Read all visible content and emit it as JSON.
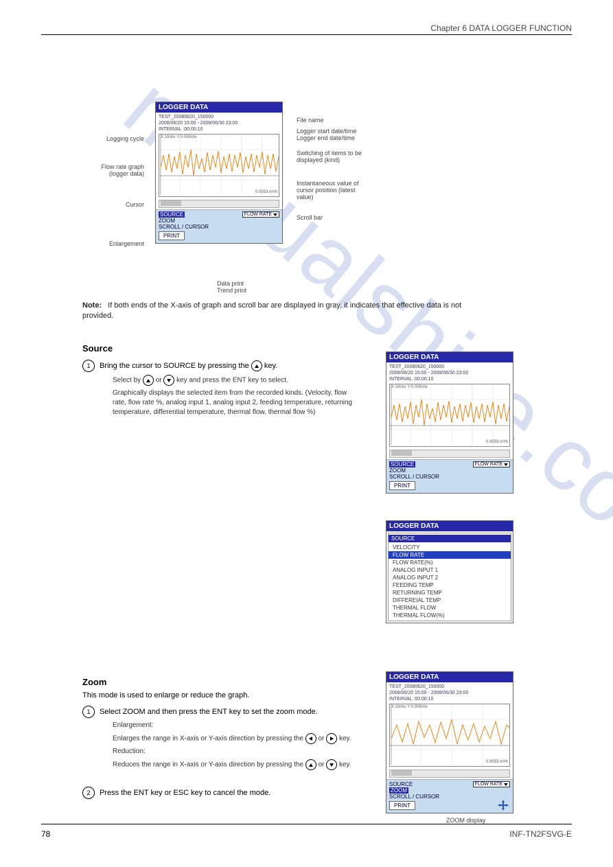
{
  "header": {
    "right_text": "Chapter 6  DATA LOGGER FUNCTION"
  },
  "panel_common": {
    "title": "LOGGER DATA",
    "file": "TEST_20080620_150000",
    "range": "2008/06/20 15:00 - 2008/06/30 23:00",
    "interval": "INTERVAL :00:00:10",
    "axis": "X:18/div Y:0.008/div",
    "value": "0.0053 m³/h"
  },
  "ctrl": {
    "source": "SOURCE",
    "flow_rate": "FLOW RATE",
    "zoom": "ZOOM",
    "scroll": "SCROLL / CURSOR",
    "print": "PRINT"
  },
  "callouts": {
    "file_name": "File name",
    "start_end": "Logger start date/time\nLogger end date/time",
    "logging_cycle": "Logging cycle",
    "switch_item": "Switching of items to be\ndisplayed (kind)",
    "flow_rate_graph": "Flow rate graph\n(logger data)",
    "instantaneous": "Instantaneous value of\ncursor position (latest\nvalue)",
    "cursor": "Cursor",
    "scroll_bar": "Scroll bar",
    "data_print": "Data print\nTrend print",
    "enlargement": "Enlargement"
  },
  "note": {
    "label": "Note:",
    "text": "If both ends of the X-axis of graph and scroll bar are displayed in gray, it indicates that effective data is not provided."
  },
  "source_section": {
    "heading": "Source",
    "step1_title": "Bring the cursor to SOURCE by pressing the ",
    "step1_title2": " key.",
    "step1_body_a": "Select by    or    key and press the ENT key to select.",
    "step1_body_b": "Graphically displays the selected item from the recorded kinds. (Velocity, flow rate, flow rate %, analog input 1, analog input 2, feeding temperature, returning temperature, differential temperature, thermal flow, thermal flow %)"
  },
  "source_menu": {
    "header": "SOURCE",
    "items": [
      "VELOCITY",
      "FLOW RATE",
      "FLOW RATE(%)",
      "ANALOG INPUT 1",
      "ANALOG INPUT 2",
      "FEEDING TEMP",
      "RETURNING TEMP",
      "DIFFEREIAL TEMP",
      "THERMAL FLOW",
      "THERMAL FLOW(%)"
    ],
    "selected_index": 1
  },
  "zoom_section": {
    "heading": "Zoom",
    "intro": "This mode is used to enlarge or reduce the graph.",
    "step1_a": "Select ZOOM and then press the ENT key to set the zoom mode.",
    "step1_b": "Enlargement:",
    "step1_c": "Enlarges the range in X-axis or Y-axis direction by pressing the    or    key.",
    "step1_d": "Reduction:",
    "step1_e": "Reduces the range in X-axis or Y-axis direction by pressing the    or    key.",
    "step2": "Press the ENT key or ESC key to cancel the mode."
  },
  "zoom_callout": "ZOOM display",
  "footer": {
    "page": "78",
    "doc": "INF-TN2FSVG-E"
  }
}
